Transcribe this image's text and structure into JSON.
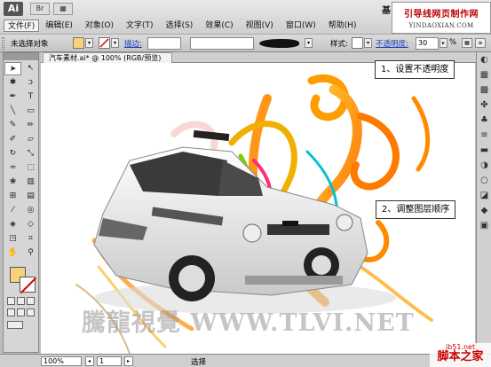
{
  "app": {
    "logo": "Ai",
    "br_label": "Br",
    "title_fragment": "基"
  },
  "menu": [
    "文件(F)",
    "编辑(E)",
    "对象(O)",
    "文字(T)",
    "选择(S)",
    "效果(C)",
    "视图(V)",
    "窗口(W)",
    "帮助(H)"
  ],
  "site": {
    "name_cn": "引导线网页制作网",
    "name_en": "YINDAOXIAN.COM"
  },
  "control_bar": {
    "selection_label": "未选择对象",
    "stroke_label": "描边:",
    "style_label": "样式:",
    "opacity_label": "不透明度:",
    "opacity_value": "30",
    "opacity_unit": "%",
    "fill_color": "#f7d27a",
    "stroke_color": "#cc0000"
  },
  "document": {
    "tab": "汽车素材.ai* @ 100% (RGB/预览)"
  },
  "tools": [
    {
      "icon": "selection-arrow-icon",
      "glyph": "➤",
      "active": true
    },
    {
      "icon": "direct-selection-icon",
      "glyph": "↖"
    },
    {
      "icon": "magic-wand-icon",
      "glyph": "✱"
    },
    {
      "icon": "lasso-icon",
      "glyph": "ↄ"
    },
    {
      "icon": "pen-icon",
      "glyph": "✒"
    },
    {
      "icon": "type-icon",
      "glyph": "T"
    },
    {
      "icon": "line-icon",
      "glyph": "╲"
    },
    {
      "icon": "rectangle-icon",
      "glyph": "▭"
    },
    {
      "icon": "paintbrush-icon",
      "glyph": "✎"
    },
    {
      "icon": "pencil-icon",
      "glyph": "✏"
    },
    {
      "icon": "blob-brush-icon",
      "glyph": "✐"
    },
    {
      "icon": "eraser-icon",
      "glyph": "▱"
    },
    {
      "icon": "rotate-icon",
      "glyph": "↻"
    },
    {
      "icon": "scale-icon",
      "glyph": "⤡"
    },
    {
      "icon": "warp-icon",
      "glyph": "≈"
    },
    {
      "icon": "free-transform-icon",
      "glyph": "⬚"
    },
    {
      "icon": "symbol-sprayer-icon",
      "glyph": "❀"
    },
    {
      "icon": "graph-icon",
      "glyph": "▥"
    },
    {
      "icon": "mesh-icon",
      "glyph": "⊞"
    },
    {
      "icon": "gradient-icon",
      "glyph": "▤"
    },
    {
      "icon": "eyedropper-icon",
      "glyph": "⁄"
    },
    {
      "icon": "blend-icon",
      "glyph": "◎"
    },
    {
      "icon": "live-paint-icon",
      "glyph": "◈"
    },
    {
      "icon": "live-paint-select-icon",
      "glyph": "◇"
    },
    {
      "icon": "artboard-icon",
      "glyph": "◳"
    },
    {
      "icon": "slice-icon",
      "glyph": "⌗"
    },
    {
      "icon": "hand-icon",
      "glyph": "✋"
    },
    {
      "icon": "zoom-icon",
      "glyph": "⚲"
    }
  ],
  "panel_icons": [
    {
      "icon": "color-panel-icon",
      "glyph": "◐"
    },
    {
      "icon": "color-guide-icon",
      "glyph": "▦"
    },
    {
      "icon": "swatches-icon",
      "glyph": "▩"
    },
    {
      "icon": "brushes-icon",
      "glyph": "✤"
    },
    {
      "icon": "symbols-icon",
      "glyph": "♣"
    },
    {
      "icon": "stroke-panel-icon",
      "glyph": "≡"
    },
    {
      "icon": "gradient-panel-icon",
      "glyph": "▬"
    },
    {
      "icon": "transparency-panel-icon",
      "glyph": "◑"
    },
    {
      "icon": "appearance-icon",
      "glyph": "○"
    },
    {
      "icon": "graphic-styles-icon",
      "glyph": "◪"
    },
    {
      "icon": "layers-icon",
      "glyph": "◆"
    },
    {
      "icon": "artboards-panel-icon",
      "glyph": "▣"
    }
  ],
  "callouts": {
    "step1": "1、设置不透明度",
    "step2": "2、调整图层顺序"
  },
  "status_bar": {
    "zoom": "100%",
    "page": "1",
    "mode": "选择"
  },
  "watermarks": {
    "tlvi": "騰龍視覺 WWW.TLVI.NET",
    "jb51_url": "jb51.net",
    "jb51_name": "脚本之家"
  }
}
